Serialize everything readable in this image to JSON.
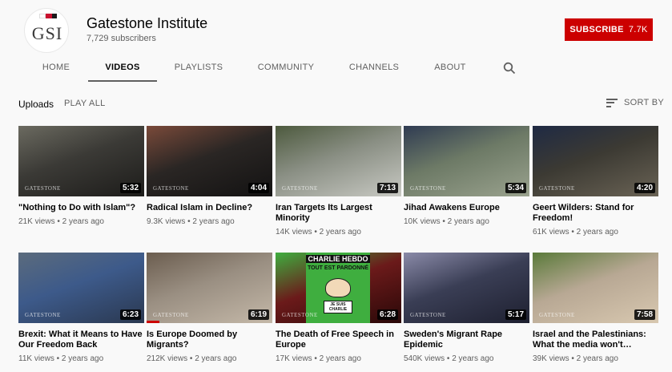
{
  "channel": {
    "name": "Gatestone Institute",
    "subscribers": "7,729 subscribers",
    "logo_text": "GSI",
    "flag_colors": [
      "#ffffff",
      "#c8102e",
      "#1b1b1b"
    ]
  },
  "subscribe": {
    "label": "SUBSCRIBE",
    "count": "7.7K",
    "color": "#cc0000"
  },
  "tabs": [
    {
      "label": "HOME",
      "active": false
    },
    {
      "label": "VIDEOS",
      "active": true
    },
    {
      "label": "PLAYLISTS",
      "active": false
    },
    {
      "label": "COMMUNITY",
      "active": false
    },
    {
      "label": "CHANNELS",
      "active": false
    },
    {
      "label": "ABOUT",
      "active": false
    }
  ],
  "section": {
    "title": "Uploads",
    "play_all": "PLAY ALL",
    "sort_by": "SORT BY"
  },
  "watermark": "GATESTONE",
  "videos": [
    {
      "title": "\"Nothing to Do with Islam\"?",
      "meta": "21K views • 2 years ago",
      "duration": "5:32",
      "colors": [
        "#3b3a36",
        "#6b6a60",
        "#1d1c1a"
      ]
    },
    {
      "title": "Radical Islam in Decline?",
      "meta": "9.3K views • 2 years ago",
      "duration": "4:04",
      "colors": [
        "#2a2624",
        "#7a4a3a",
        "#131212"
      ]
    },
    {
      "title": "Iran Targets Its Largest Minority",
      "meta": "14K views • 2 years ago",
      "duration": "7:13",
      "colors": [
        "#8a8f84",
        "#4d5a3e",
        "#c8c9c3"
      ]
    },
    {
      "title": "Jihad Awakens Europe",
      "meta": "10K views • 2 years ago",
      "duration": "5:34",
      "colors": [
        "#6d7a66",
        "#2f3b52",
        "#9aa28e"
      ]
    },
    {
      "title": "Geert Wilders: Stand for Freedom!",
      "meta": "61K views • 2 years ago",
      "duration": "4:20",
      "colors": [
        "#3c3a33",
        "#1f2a44",
        "#6a6355"
      ]
    },
    {
      "title": "Brexit: What it Means to Have Our Freedom Back",
      "meta": "11K views • 2 years ago",
      "duration": "6:23",
      "colors": [
        "#3d5a8a",
        "#5b6b7d",
        "#2a3850"
      ],
      "progress": 0
    },
    {
      "title": "Is Europe Doomed by Migrants?",
      "meta": "212K views • 2 years ago",
      "duration": "6:19",
      "colors": [
        "#9a8f82",
        "#6b5d4f",
        "#c4b8a8"
      ],
      "progress": 0.1
    },
    {
      "title": "The Death of Free Speech in Europe",
      "meta": "17K views • 2 years ago",
      "duration": "6:28",
      "colors": [
        "#6b1a1a",
        "#3fae3f",
        "#2a0808"
      ]
    },
    {
      "title": "Sweden's Migrant Rape Epidemic",
      "meta": "540K views • 2 years ago",
      "duration": "5:17",
      "colors": [
        "#3a3e55",
        "#8a8aa8",
        "#1e2030"
      ]
    },
    {
      "title": "Israel and the Palestinians: What the media won't…",
      "meta": "39K views • 2 years ago",
      "duration": "7:58",
      "colors": [
        "#b8a894",
        "#5a7a3a",
        "#d8c8b0"
      ]
    }
  ],
  "charlie": {
    "line1": "CHARLIE HEBDO",
    "line2": "TOUT EST PARDONNÉ",
    "line3": "JE SUIS CHARLIE"
  }
}
